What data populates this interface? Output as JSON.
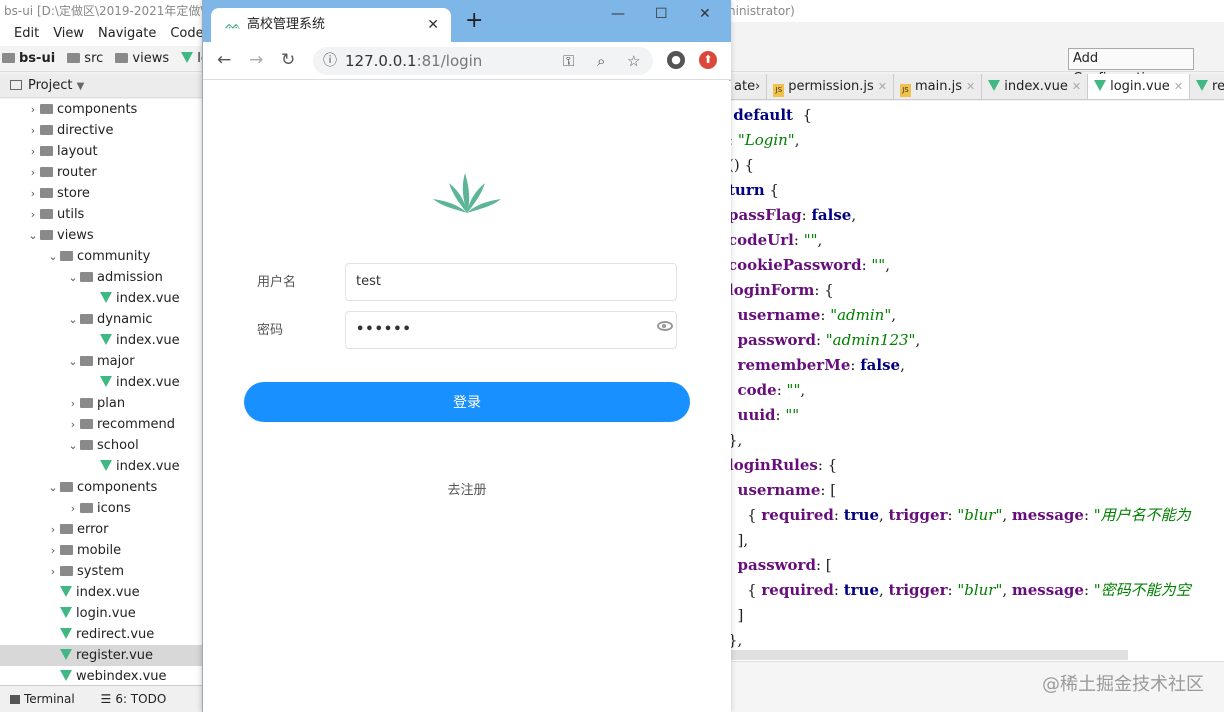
{
  "ide": {
    "title_left": "bs-ui [D:\\定做区\\2019-2021年定做\\",
    "title_right": "ninistrator)",
    "menu": [
      "Edit",
      "View",
      "Navigate",
      "Code",
      "R"
    ],
    "breadcrumb": [
      "bs-ui",
      "src",
      "views",
      "logi"
    ],
    "project_label": "Project",
    "tree": [
      {
        "label": "components",
        "type": "folder",
        "indent": 1,
        "arrow": "›"
      },
      {
        "label": "directive",
        "type": "folder",
        "indent": 1,
        "arrow": "›"
      },
      {
        "label": "layout",
        "type": "folder",
        "indent": 1,
        "arrow": "›"
      },
      {
        "label": "router",
        "type": "folder",
        "indent": 1,
        "arrow": "›"
      },
      {
        "label": "store",
        "type": "folder",
        "indent": 1,
        "arrow": "›"
      },
      {
        "label": "utils",
        "type": "folder",
        "indent": 1,
        "arrow": "›"
      },
      {
        "label": "views",
        "type": "folder",
        "indent": 1,
        "arrow": "⌄"
      },
      {
        "label": "community",
        "type": "folder",
        "indent": 2,
        "arrow": "⌄"
      },
      {
        "label": "admission",
        "type": "folder",
        "indent": 3,
        "arrow": "⌄"
      },
      {
        "label": "index.vue",
        "type": "vue",
        "indent": 4,
        "arrow": ""
      },
      {
        "label": "dynamic",
        "type": "folder",
        "indent": 3,
        "arrow": "⌄"
      },
      {
        "label": "index.vue",
        "type": "vue",
        "indent": 4,
        "arrow": ""
      },
      {
        "label": "major",
        "type": "folder",
        "indent": 3,
        "arrow": "⌄"
      },
      {
        "label": "index.vue",
        "type": "vue",
        "indent": 4,
        "arrow": ""
      },
      {
        "label": "plan",
        "type": "folder",
        "indent": 3,
        "arrow": "›"
      },
      {
        "label": "recommend",
        "type": "folder",
        "indent": 3,
        "arrow": "›"
      },
      {
        "label": "school",
        "type": "folder",
        "indent": 3,
        "arrow": "⌄"
      },
      {
        "label": "index.vue",
        "type": "vue",
        "indent": 4,
        "arrow": ""
      },
      {
        "label": "components",
        "type": "folder",
        "indent": 2,
        "arrow": "⌄"
      },
      {
        "label": "icons",
        "type": "folder",
        "indent": 3,
        "arrow": "›"
      },
      {
        "label": "error",
        "type": "folder",
        "indent": 2,
        "arrow": "›"
      },
      {
        "label": "mobile",
        "type": "folder",
        "indent": 2,
        "arrow": "›"
      },
      {
        "label": "system",
        "type": "folder",
        "indent": 2,
        "arrow": "›"
      },
      {
        "label": "index.vue",
        "type": "vue",
        "indent": 2,
        "arrow": ""
      },
      {
        "label": "login.vue",
        "type": "vue",
        "indent": 2,
        "arrow": ""
      },
      {
        "label": "redirect.vue",
        "type": "vue",
        "indent": 2,
        "arrow": ""
      },
      {
        "label": "register.vue",
        "type": "vue",
        "indent": 2,
        "arrow": "",
        "selected": true
      },
      {
        "label": "webindex.vue",
        "type": "vue",
        "indent": 2,
        "arrow": ""
      }
    ],
    "bottom": {
      "terminal": "Terminal",
      "todo": "6: TODO"
    },
    "add_config": "Add Configuration...",
    "tabs": [
      {
        "label": "ate›",
        "icon": "",
        "active": false
      },
      {
        "label": "permission.js",
        "icon": "js",
        "active": false
      },
      {
        "label": "main.js",
        "icon": "js",
        "active": false
      },
      {
        "label": "index.vue",
        "icon": "vue",
        "active": false
      },
      {
        "label": "login.vue",
        "icon": "vue",
        "active": true
      },
      {
        "label": "reg",
        "icon": "vue",
        "active": false
      }
    ],
    "code_lines": [
      [
        [
          "kw",
          " default"
        ],
        [
          "",
          "  {"
        ]
      ],
      [
        [
          "",
          ": "
        ],
        [
          "str",
          "\"Login\""
        ],
        [
          "",
          ","
        ]
      ],
      [
        [
          "",
          "() {"
        ]
      ],
      [
        [
          "kw",
          "turn"
        ],
        [
          "",
          " {"
        ]
      ],
      [
        [
          "prop",
          "passFlag"
        ],
        [
          "",
          ": "
        ],
        [
          "kw",
          "false"
        ],
        [
          "",
          ","
        ]
      ],
      [
        [
          "prop",
          "codeUrl"
        ],
        [
          "",
          ": "
        ],
        [
          "str",
          "\"\""
        ],
        [
          "",
          ","
        ]
      ],
      [
        [
          "prop",
          "cookiePassword"
        ],
        [
          "",
          ": "
        ],
        [
          "str",
          "\"\""
        ],
        [
          "",
          ","
        ]
      ],
      [
        [
          "prop",
          "loginForm"
        ],
        [
          "",
          ": {"
        ]
      ],
      [
        [
          "",
          "  "
        ],
        [
          "prop",
          "username"
        ],
        [
          "",
          ": "
        ],
        [
          "str",
          "\"admin\""
        ],
        [
          "",
          ","
        ]
      ],
      [
        [
          "",
          "  "
        ],
        [
          "prop",
          "password"
        ],
        [
          "",
          ": "
        ],
        [
          "str",
          "\"admin123\""
        ],
        [
          "",
          ","
        ]
      ],
      [
        [
          "",
          "  "
        ],
        [
          "prop",
          "rememberMe"
        ],
        [
          "",
          ": "
        ],
        [
          "kw",
          "false"
        ],
        [
          "",
          ","
        ]
      ],
      [
        [
          "",
          "  "
        ],
        [
          "prop",
          "code"
        ],
        [
          "",
          ": "
        ],
        [
          "str",
          "\"\""
        ],
        [
          "",
          ","
        ]
      ],
      [
        [
          "",
          "  "
        ],
        [
          "prop",
          "uuid"
        ],
        [
          "",
          ": "
        ],
        [
          "str",
          "\"\""
        ]
      ],
      [
        [
          "",
          "},"
        ]
      ],
      [
        [
          "prop",
          "loginRules"
        ],
        [
          "",
          ": {"
        ]
      ],
      [
        [
          "",
          "  "
        ],
        [
          "prop",
          "username"
        ],
        [
          "",
          ": ["
        ]
      ],
      [
        [
          "",
          "    { "
        ],
        [
          "prop",
          "required"
        ],
        [
          "",
          ": "
        ],
        [
          "kw",
          "true"
        ],
        [
          "",
          ", "
        ],
        [
          "prop",
          "trigger"
        ],
        [
          "",
          ": "
        ],
        [
          "str",
          "\"blur\""
        ],
        [
          "",
          ", "
        ],
        [
          "prop",
          "message"
        ],
        [
          "",
          ": "
        ],
        [
          "str",
          "\"用户名不能为"
        ]
      ],
      [
        [
          "",
          "  ],"
        ]
      ],
      [
        [
          "",
          "  "
        ],
        [
          "prop",
          "password"
        ],
        [
          "",
          ": ["
        ]
      ],
      [
        [
          "",
          "    { "
        ],
        [
          "prop",
          "required"
        ],
        [
          "",
          ": "
        ],
        [
          "kw",
          "true"
        ],
        [
          "",
          ", "
        ],
        [
          "prop",
          "trigger"
        ],
        [
          "",
          ": "
        ],
        [
          "str",
          "\"blur\""
        ],
        [
          "",
          ", "
        ],
        [
          "prop",
          "message"
        ],
        [
          "",
          ": "
        ],
        [
          "str",
          "\"密码不能为空"
        ]
      ],
      [
        [
          "",
          "  ]"
        ]
      ],
      [
        [
          "",
          "},"
        ]
      ]
    ],
    "watermark": "@稀土掘金技术社区"
  },
  "browser": {
    "tab_title": "高校管理系统",
    "new_tab": "+",
    "url_host": "127.0.0.1",
    "url_rest": ":81/login"
  },
  "login": {
    "username_label": "用户名",
    "username_value": "test",
    "password_label": "密码",
    "password_value": "••••••",
    "login_button": "登录",
    "register_link": "去注册"
  }
}
